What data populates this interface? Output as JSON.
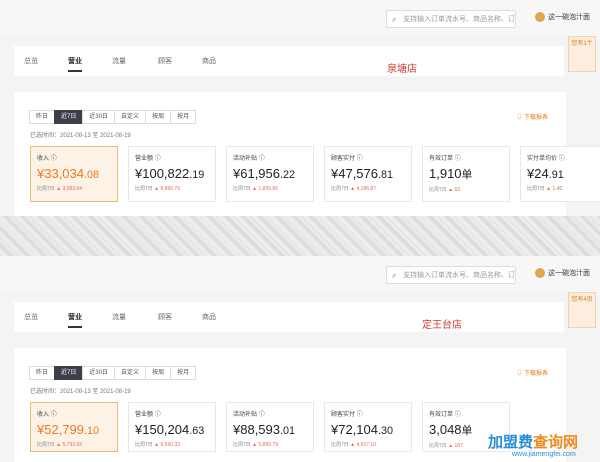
{
  "search_placeholder": "支持输入订单流水号、商品名称、订",
  "user_name": "这一碗泡汁面",
  "tabs": [
    "总览",
    "营业",
    "流量",
    "顾客",
    "商品"
  ],
  "ranges": [
    "昨日",
    "近7日",
    "近30日",
    "自定义",
    "按周",
    "按月"
  ],
  "download": "下载报表",
  "floats": [
    "您有1个",
    "您有4页"
  ],
  "stores": [
    {
      "name": "泉塘店",
      "time_label": "已选时间：",
      "start": "2021-08-13",
      "to": "至",
      "end": "2021-08-19",
      "metrics": [
        {
          "label": "收入",
          "int": "¥33,034",
          "dec": ".08",
          "cmp": "比周7日",
          "delta": "3,083.64"
        },
        {
          "label": "营业额",
          "int": "¥100,822",
          "dec": ".19",
          "cmp": "比周7日",
          "delta": "8,866.79"
        },
        {
          "label": "活动补贴",
          "int": "¥61,956",
          "dec": ".22",
          "cmp": "比周7日",
          "delta": "1,855.86"
        },
        {
          "label": "顾客实付",
          "int": "¥47,576",
          "dec": ".81",
          "cmp": "比周7日",
          "delta": "4,186.87"
        },
        {
          "label": "有效订单",
          "int": "1,910",
          "dec": "单",
          "cmp": "比周7日",
          "delta": "63"
        },
        {
          "label": "实付单均价",
          "int": "¥24",
          "dec": ".91",
          "cmp": "比周7日",
          "delta": "1.40"
        }
      ]
    },
    {
      "name": "定王台店",
      "time_label": "已选时间：",
      "start": "2021-08-13",
      "to": "至",
      "end": "2021-08-19",
      "metrics": [
        {
          "label": "收入",
          "int": "¥52,799",
          "dec": ".10",
          "cmp": "比周7日",
          "delta": "5,793.92"
        },
        {
          "label": "营业额",
          "int": "¥150,204",
          "dec": ".63",
          "cmp": "比周7日",
          "delta": "9,560.33"
        },
        {
          "label": "活动补贴",
          "int": "¥88,593",
          "dec": ".01",
          "cmp": "比周7日",
          "delta": "5,889.79"
        },
        {
          "label": "顾客实付",
          "int": "¥72,104",
          "dec": ".30",
          "cmp": "比周7日",
          "delta": "4,927.10"
        },
        {
          "label": "有效订单",
          "int": "3,048",
          "dec": "单",
          "cmp": "比周7日",
          "delta": "187"
        }
      ]
    }
  ],
  "watermark": {
    "brand_a": "加盟费",
    "brand_b": "查询网",
    "url": "www.jiamengfei.com"
  }
}
